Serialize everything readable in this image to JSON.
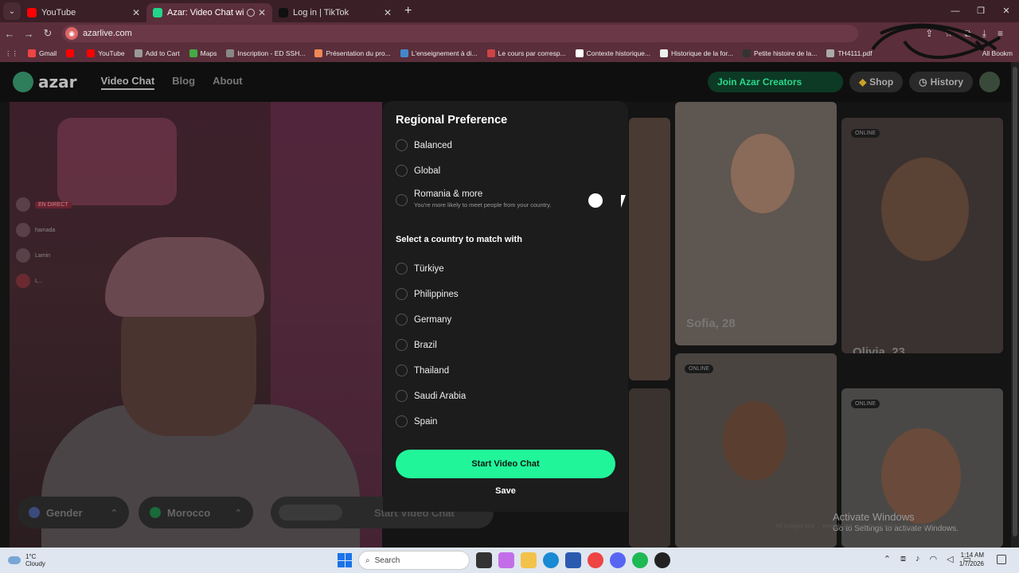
{
  "browser": {
    "tabs": [
      {
        "title": "YouTube",
        "color": "#ff0000",
        "active": false
      },
      {
        "title": "Azar: Video Chat with New",
        "color": "#1fd68a",
        "active": true
      },
      {
        "title": "Log in | TikTok",
        "color": "#111111",
        "active": false
      }
    ],
    "new_tab": "+",
    "url": "azarlive.com",
    "bookmarks": [
      {
        "label": "Gmail",
        "color": "#e44"
      },
      {
        "label": "",
        "color": "#f00"
      },
      {
        "label": "YouTube",
        "color": "#f00"
      },
      {
        "label": "Add to Cart",
        "color": "#999"
      },
      {
        "label": "Maps",
        "color": "#4a4"
      },
      {
        "label": "Inscription - ED SSH...",
        "color": "#888"
      },
      {
        "label": "Présentation du pro...",
        "color": "#e85"
      },
      {
        "label": "L'enseignement à di...",
        "color": "#48c"
      },
      {
        "label": "Le cours par corresp...",
        "color": "#c44"
      },
      {
        "label": "Contexte historique...",
        "color": "#fff"
      },
      {
        "label": "Historique de la for...",
        "color": "#eee"
      },
      {
        "label": "Petite histoire de la...",
        "color": "#333"
      },
      {
        "label": "TH4111.pdf",
        "color": "#aaa"
      }
    ],
    "all_bookmarks": "All Bookm"
  },
  "site": {
    "logo": "azar",
    "nav": [
      "Video Chat",
      "Blog",
      "About"
    ],
    "join_creators": "Join Azar Creators",
    "shop": "Shop",
    "history": "History"
  },
  "stream_chat": {
    "live_badge": "EN DIRECT",
    "users": [
      "hamada",
      "Lamin",
      "L..."
    ]
  },
  "bottom_controls": {
    "gender": "Gender",
    "country": "Morocco",
    "start": "Start Video Chat"
  },
  "profiles": [
    {
      "name": "Sofia, 28",
      "online": ""
    },
    {
      "name": "Olivia, 23",
      "online": "ONLINE"
    },
    {
      "name": "",
      "online": "ONLINE"
    },
    {
      "name": "",
      "online": "ONLINE"
    }
  ],
  "modal": {
    "title": "Regional Preference",
    "options": [
      {
        "label": "Balanced",
        "sub": ""
      },
      {
        "label": "Global",
        "sub": ""
      },
      {
        "label": "Romania & more",
        "sub": "You're more likely to meet people from your country."
      }
    ],
    "section_title": "Select a country to match with",
    "countries": [
      "Türkiye",
      "Philippines",
      "Germany",
      "Brazil",
      "Thailand",
      "Saudi Arabia",
      "Spain"
    ],
    "start_button": "Start Video Chat",
    "save_button": "Save"
  },
  "windows": {
    "activate_title": "Activate Windows",
    "activate_sub": "Go to Settings to activate Windows.",
    "illustrative_note": "All images and ... models are used for illustrative purposes",
    "weather_temp": "1°C",
    "weather_desc": "Cloudy",
    "search": "Search",
    "time": "1:14 AM",
    "date": "1/7/2026"
  }
}
